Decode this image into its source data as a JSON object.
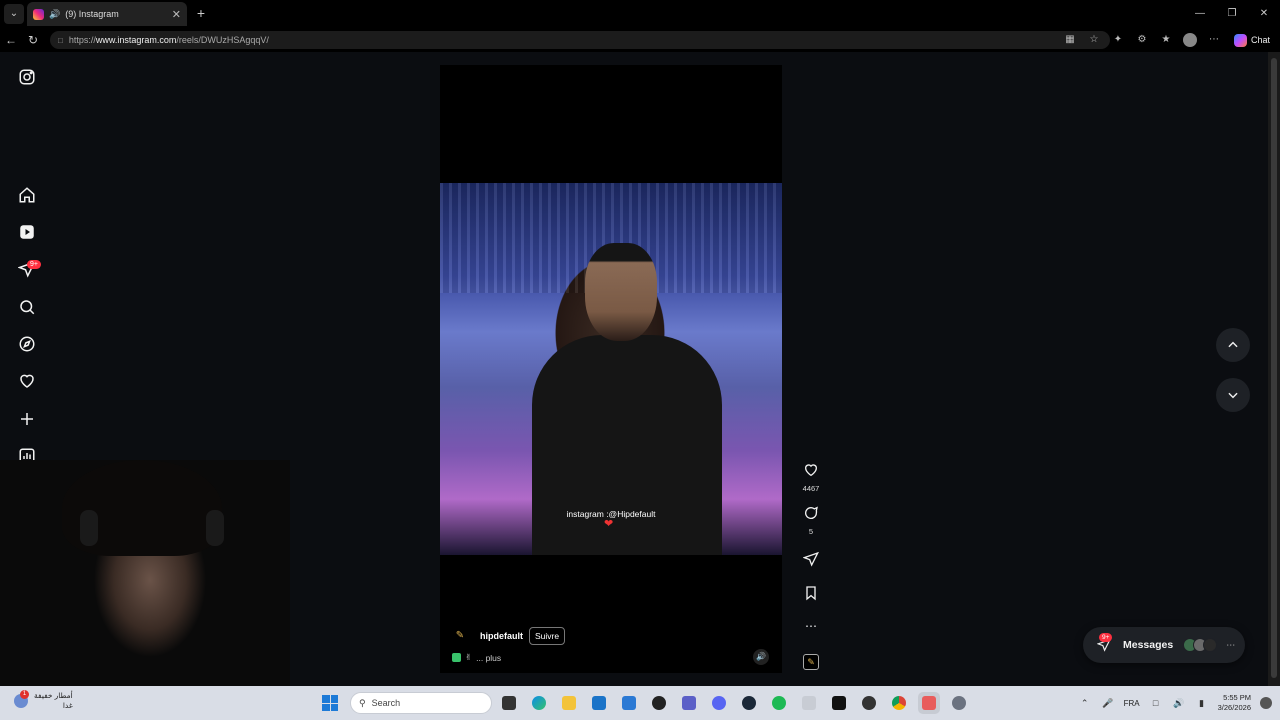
{
  "browser": {
    "tab_title": "(9) Instagram",
    "url_prefix": "https://",
    "url_host": "www.instagram.com",
    "url_path": "/reels/DWUzHSAgqqV/",
    "chat_label": "Chat"
  },
  "sidebar": {
    "notification_badge": "9+"
  },
  "reel": {
    "overlay_text": "instagram :@Hipdefault",
    "username": "hipdefault",
    "follow_label": "Suivre",
    "description_more": "... plus",
    "likes_count": "4467",
    "comments_count": "5"
  },
  "messages": {
    "label": "Messages",
    "badge": "9+"
  },
  "taskbar": {
    "weather_line1": "أمطار خفيفة",
    "weather_line2": "غدا",
    "weather_badge": "1",
    "search_placeholder": "Search",
    "language": "FRA",
    "time": "5:55 PM",
    "date": "3/26/2026"
  },
  "colors": {
    "accent_red": "#ff3040",
    "page_background": "#0b0d11",
    "taskbar_background": "#d9dde6"
  },
  "icons": {
    "sidebar": [
      "instagram-logo-icon",
      "home-icon",
      "reels-icon",
      "messages-icon",
      "search-icon",
      "explore-icon",
      "heart-icon",
      "create-icon",
      "dashboard-icon",
      "profile-avatar-icon"
    ],
    "actions": [
      "like-icon",
      "comment-icon",
      "share-icon",
      "save-icon",
      "more-icon",
      "audio-thumbnail-icon"
    ]
  }
}
